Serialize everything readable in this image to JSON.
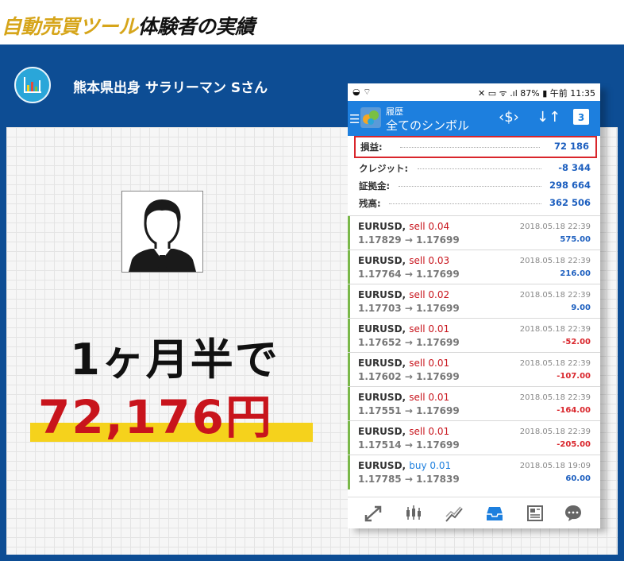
{
  "title": {
    "part1": "自動売買ツール",
    "part2": "体験者の実績"
  },
  "header": {
    "text": "熊本県出身 サラリーマン Sさん"
  },
  "result": {
    "line1": "1ヶ月半で",
    "line2": "72,176円"
  },
  "phone": {
    "status_left": "◒ ⌔",
    "status_right": "✕ ▭ ᯤ .ıl 87% ▮ 午前 11:35",
    "app_subtitle": "履歴",
    "app_title": "全てのシンボル",
    "summary": [
      {
        "label": "損益:",
        "value": "72 186"
      },
      {
        "label": "クレジット:",
        "value": "-8 344"
      },
      {
        "label": "証拠金:",
        "value": "298 664"
      },
      {
        "label": "残高:",
        "value": "362 506"
      }
    ],
    "trades": [
      {
        "symbol": "EURUSD,",
        "side": "sell 0.04",
        "prices": "1.17829 → 1.17699",
        "time": "2018.05.18 22:39",
        "pl": "575.00"
      },
      {
        "symbol": "EURUSD,",
        "side": "sell 0.03",
        "prices": "1.17764 → 1.17699",
        "time": "2018.05.18 22:39",
        "pl": "216.00"
      },
      {
        "symbol": "EURUSD,",
        "side": "sell 0.02",
        "prices": "1.17703 → 1.17699",
        "time": "2018.05.18 22:39",
        "pl": "9.00"
      },
      {
        "symbol": "EURUSD,",
        "side": "sell 0.01",
        "prices": "1.17652 → 1.17699",
        "time": "2018.05.18 22:39",
        "pl": "-52.00"
      },
      {
        "symbol": "EURUSD,",
        "side": "sell 0.01",
        "prices": "1.17602 → 1.17699",
        "time": "2018.05.18 22:39",
        "pl": "-107.00"
      },
      {
        "symbol": "EURUSD,",
        "side": "sell 0.01",
        "prices": "1.17551 → 1.17699",
        "time": "2018.05.18 22:39",
        "pl": "-164.00"
      },
      {
        "symbol": "EURUSD,",
        "side": "sell 0.01",
        "prices": "1.17514 → 1.17699",
        "time": "2018.05.18 22:39",
        "pl": "-205.00"
      },
      {
        "symbol": "EURUSD,",
        "side": "buy 0.01",
        "prices": "1.17785 → 1.17839",
        "time": "2018.05.18 19:09",
        "pl": "60.00"
      }
    ],
    "calendar_day": "3",
    "nav_icons": [
      "trade-icon",
      "quotes-chart-icon",
      "chart-icon",
      "history-icon",
      "news-icon",
      "chat-icon"
    ]
  },
  "colors": {
    "gold": "#d6a51a",
    "frame_blue": "#0d4d94",
    "accent_red": "#c8141c",
    "app_blue": "#1d7fde",
    "profit_blue": "#1d5fbf",
    "loss_red": "#d9262c",
    "sell_red": "#c8141c",
    "buy_blue": "#1d7fde"
  }
}
